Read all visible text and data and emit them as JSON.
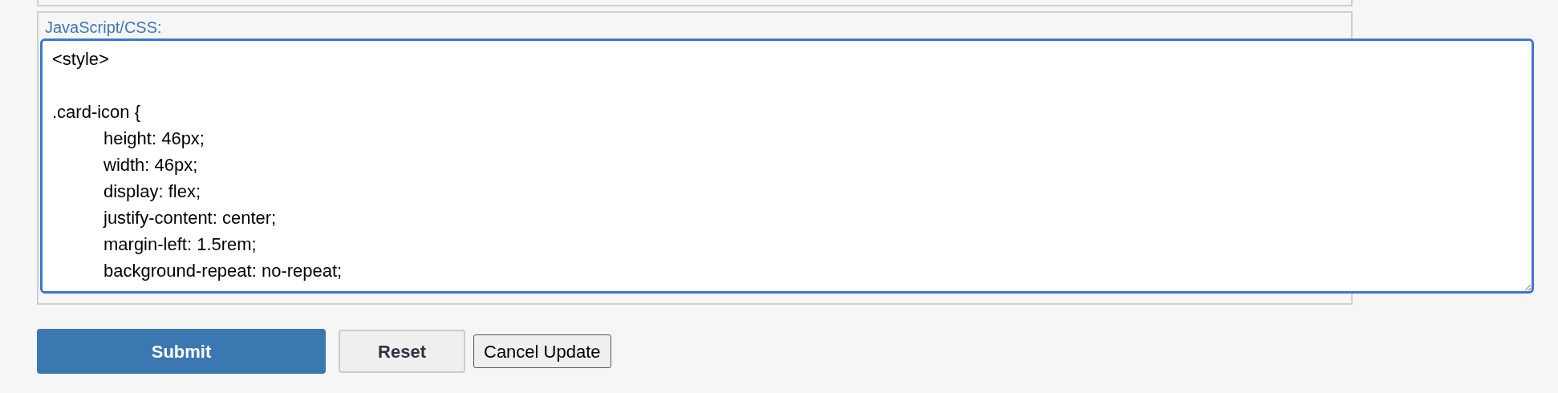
{
  "field": {
    "label": "JavaScript/CSS:",
    "focused": true,
    "value": "<style>\n\n.card-icon {\n\theight: 46px;\n\twidth: 46px;\n\tdisplay: flex;\n\tjustify-content: center;\n\tmargin-left: 1.5rem;\n\tbackground-repeat: no-repeat;"
  },
  "buttons": [
    {
      "label": "Submit",
      "kind": "primary"
    },
    {
      "label": "Reset",
      "kind": "secondary"
    },
    {
      "label": "Cancel Update",
      "kind": "native"
    }
  ]
}
